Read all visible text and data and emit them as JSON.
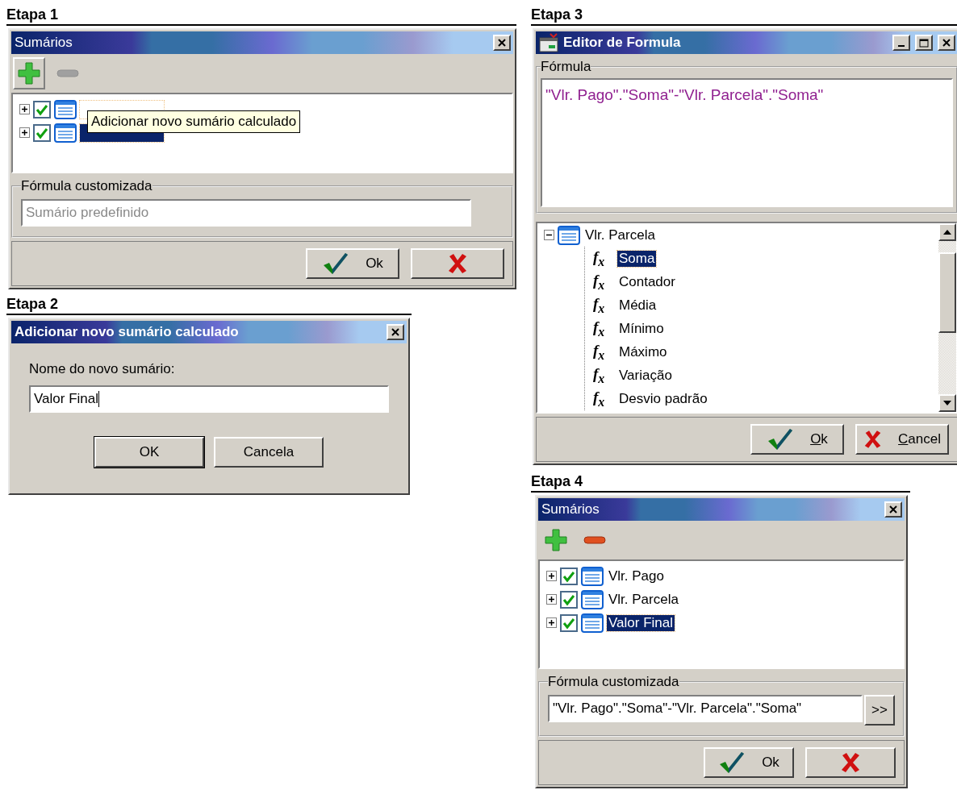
{
  "steps": [
    {
      "heading": "Etapa 1",
      "kind": "summaries",
      "title": "Sumários",
      "toolbar": [
        {
          "kind": "add",
          "hovered": true,
          "disabled": false
        },
        {
          "kind": "remove",
          "hovered": false,
          "disabled": true
        }
      ],
      "tree": [
        {
          "checked": true,
          "expanded": false,
          "selected": false
        },
        {
          "checked": true,
          "expanded": false,
          "selected": true
        }
      ],
      "tooltip": "Adicionar novo sumário calculado",
      "formula_group": {
        "label": "Fórmula customizada",
        "placeholder": "Sumário predefinido"
      },
      "buttons": [
        {
          "kind": "ok",
          "label": "Ok",
          "mnemonic": false
        },
        {
          "kind": "cancel"
        }
      ]
    },
    {
      "heading": "Etapa 2",
      "kind": "prompt",
      "title": "Adicionar novo sumário calculado",
      "prompt": "Nome do novo sumário:",
      "value": "Valor Final",
      "buttons": [
        {
          "kind": "text",
          "label": "OK",
          "default": true
        },
        {
          "kind": "text",
          "label": "Cancela",
          "default": false
        }
      ]
    },
    {
      "heading": "Etapa 3",
      "kind": "editor",
      "title": "Editor de Formula",
      "formula_group": {
        "label": "Fórmula",
        "value": "\"Vlr. Pago\".\"Soma\"-\"Vlr. Parcela\".\"Soma\""
      },
      "tree": [
        {
          "label": "Vlr. Parcela",
          "expanded": true,
          "selected": false,
          "children": [
            {
              "glyph": "f$_{x}$",
              "label": "Soma",
              "selected": true
            },
            {
              "glyph": "f$_{x}$",
              "label": "Contador",
              "selected": false
            },
            {
              "glyph": "f$_{x}$",
              "label": "Média",
              "selected": false
            },
            {
              "glyph": "f$_{x}$",
              "label": "Mínimo",
              "selected": false
            },
            {
              "glyph": "f$_{x}$",
              "label": "Máximo",
              "selected": false
            },
            {
              "glyph": "f$_{x}$",
              "label": "Variação",
              "selected": false
            },
            {
              "glyph": "f$_{x}$",
              "label": "Desvio padrão",
              "selected": false
            }
          ]
        }
      ],
      "buttons": [
        {
          "kind": "ok",
          "label": "Ok",
          "mnemonic": true
        },
        {
          "kind": "cancel",
          "label": "Cancel",
          "mnemonic": true
        }
      ]
    },
    {
      "heading": "Etapa 4",
      "kind": "summaries",
      "title": "Sumários",
      "toolbar": [
        {
          "kind": "add",
          "hovered": false,
          "disabled": false
        },
        {
          "kind": "remove",
          "hovered": false,
          "disabled": false
        }
      ],
      "tree": [
        {
          "label": "Vlr. Pago",
          "checked": true,
          "expanded": false,
          "selected": false
        },
        {
          "label": "Vlr. Parcela",
          "checked": true,
          "expanded": false,
          "selected": false
        },
        {
          "label": "Valor Final",
          "checked": true,
          "expanded": false,
          "selected": true
        }
      ],
      "formula_group": {
        "label": "Fórmula customizada",
        "value": "\"Vlr. Pago\".\"Soma\"-\"Vlr. Parcela\".\"Soma\"",
        "button": ">>"
      },
      "buttons": [
        {
          "kind": "ok",
          "label": "Ok",
          "mnemonic": false
        },
        {
          "kind": "cancel"
        }
      ]
    }
  ]
}
